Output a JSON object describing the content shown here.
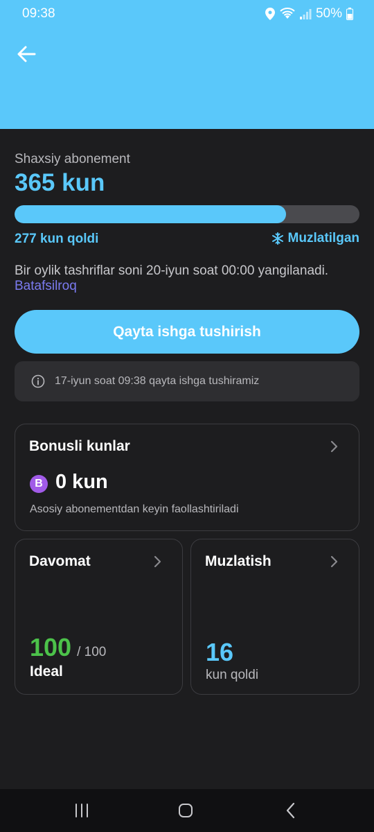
{
  "theme": {
    "accent": "#5ac8fa",
    "success": "#4cc24a",
    "bonus": "#a15be8",
    "link": "#7b7bf0"
  },
  "status_bar": {
    "time": "09:38",
    "battery": "50%",
    "icons": [
      "location-icon",
      "wifi-icon",
      "signal-icon",
      "battery-icon"
    ]
  },
  "header": {
    "back_icon": "arrow-left-icon"
  },
  "subscription": {
    "type": "Shaxsiy abonement",
    "duration": "365 kun",
    "progress_fraction": 0.787,
    "remaining": "277 kun qoldi",
    "frozen_label": "Muzlatilgan",
    "notice": "Bir oylik tashriflar soni 20-iyun soat 00:00 yangilanadi.",
    "more_link": "Batafsilroq"
  },
  "restart": {
    "button_label": "Qayta ishga tushirish",
    "info": "17-iyun soat 09:38 qayta ishga tushiramiz"
  },
  "bonus_card": {
    "title": "Bonusli kunlar",
    "badge": "B",
    "days": "0 kun",
    "description": "Asosiy abonementdan keyin faollashtiriladi"
  },
  "attendance_card": {
    "title": "Davomat",
    "score": "100",
    "max": "/ 100",
    "label": "Ideal"
  },
  "freeze_card": {
    "title": "Muzlatish",
    "count": "16",
    "label": "kun qoldi"
  },
  "nav_bar": {
    "items": [
      "recents-icon",
      "home-icon",
      "back-icon"
    ]
  }
}
